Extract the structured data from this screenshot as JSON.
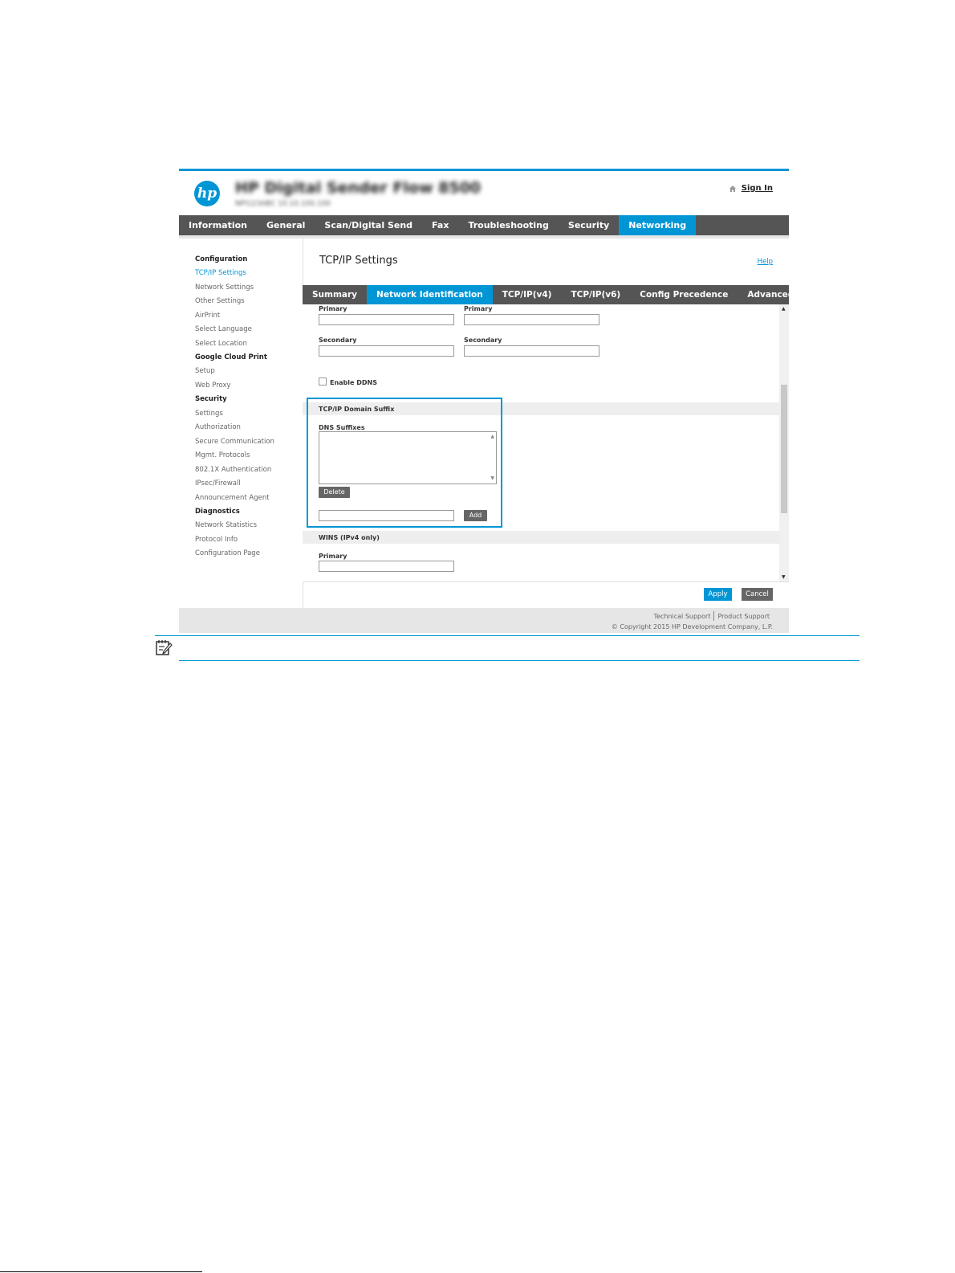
{
  "header": {
    "logo_text": "hp",
    "product_name": "HP Digital Sender Flow 8500",
    "product_sub": "NPI123ABC     10.10.100.100",
    "signin_label": "Sign In"
  },
  "main_nav": {
    "tabs": [
      {
        "label": "Information",
        "active": false
      },
      {
        "label": "General",
        "active": false
      },
      {
        "label": "Scan/Digital Send",
        "active": false
      },
      {
        "label": "Fax",
        "active": false
      },
      {
        "label": "Troubleshooting",
        "active": false
      },
      {
        "label": "Security",
        "active": false
      },
      {
        "label": "Networking",
        "active": true
      }
    ]
  },
  "sidebar": {
    "items": [
      {
        "label": "Configuration",
        "type": "header"
      },
      {
        "label": "TCP/IP Settings",
        "type": "active"
      },
      {
        "label": "Network Settings",
        "type": "link"
      },
      {
        "label": "Other Settings",
        "type": "link"
      },
      {
        "label": "AirPrint",
        "type": "link"
      },
      {
        "label": "Select Language",
        "type": "link"
      },
      {
        "label": "Select Location",
        "type": "link"
      },
      {
        "label": "Google Cloud Print",
        "type": "header"
      },
      {
        "label": "Setup",
        "type": "link"
      },
      {
        "label": "Web Proxy",
        "type": "link"
      },
      {
        "label": "Security",
        "type": "header"
      },
      {
        "label": "Settings",
        "type": "link"
      },
      {
        "label": "Authorization",
        "type": "link"
      },
      {
        "label": "Secure Communication",
        "type": "link"
      },
      {
        "label": "Mgmt. Protocols",
        "type": "link"
      },
      {
        "label": "802.1X Authentication",
        "type": "link"
      },
      {
        "label": "IPsec/Firewall",
        "type": "link"
      },
      {
        "label": "Announcement Agent",
        "type": "link"
      },
      {
        "label": "Diagnostics",
        "type": "header"
      },
      {
        "label": "Network Statistics",
        "type": "link"
      },
      {
        "label": "Protocol Info",
        "type": "link"
      },
      {
        "label": "Configuration Page",
        "type": "link"
      }
    ]
  },
  "content": {
    "title": "TCP/IP Settings",
    "help_label": "Help",
    "sub_tabs": [
      {
        "label": "Summary",
        "active": false
      },
      {
        "label": "Network Identification",
        "active": true
      },
      {
        "label": "TCP/IP(v4)",
        "active": false
      },
      {
        "label": "TCP/IP(v6)",
        "active": false
      },
      {
        "label": "Config Precedence",
        "active": false
      },
      {
        "label": "Advanced",
        "active": false
      }
    ],
    "form": {
      "primary_left_label": "Primary",
      "primary_right_label": "Primary",
      "secondary_left_label": "Secondary",
      "secondary_right_label": "Secondary",
      "primary_left_value": "",
      "primary_right_value": "",
      "secondary_left_value": "",
      "secondary_right_value": "",
      "enable_ddns_label": "Enable DDNS",
      "enable_ddns_checked": false,
      "domain_suffix_title": "TCP/IP Domain Suffix",
      "dns_suffixes_label": "DNS Suffixes",
      "delete_label": "Delete",
      "suffix_input_value": "",
      "add_label": "Add",
      "wins_title": "WINS (IPv4 only)",
      "wins_primary_label": "Primary",
      "wins_primary_value": ""
    },
    "apply_label": "Apply",
    "cancel_label": "Cancel"
  },
  "footer": {
    "technical_support": "Technical Support",
    "product_support": "Product Support",
    "copyright": "© Copyright 2015 HP Development Company, L.P."
  },
  "colors": {
    "accent": "#0096d6",
    "nav_bg": "#555555",
    "footer_bg": "#e6e6e6"
  }
}
